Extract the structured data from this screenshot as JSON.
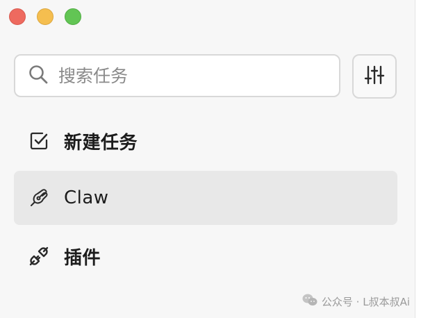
{
  "window": {
    "controls": [
      "close",
      "minimize",
      "maximize"
    ],
    "colors": {
      "close": "#ee6a5f",
      "minimize": "#f5be4f",
      "maximize": "#62c554"
    }
  },
  "search": {
    "icon": "search-icon",
    "placeholder": "搜索任务",
    "value": ""
  },
  "filter_button": {
    "icon": "sliders-icon"
  },
  "nav": {
    "items": [
      {
        "label": "新建任务",
        "icon": "checkbox-edit-icon",
        "active": false
      },
      {
        "label": "Claw",
        "icon": "claw-icon",
        "active": true
      },
      {
        "label": "插件",
        "icon": "plug-icon",
        "active": false
      }
    ]
  },
  "watermark": {
    "icon": "wechat-icon",
    "text": "公众号 · L叔本叔Ai"
  },
  "colors": {
    "sidebar_bg": "#f7f7f7",
    "active_item_bg": "#e8e8e8",
    "text": "#1c1c1c",
    "placeholder": "#8a8a8a"
  }
}
